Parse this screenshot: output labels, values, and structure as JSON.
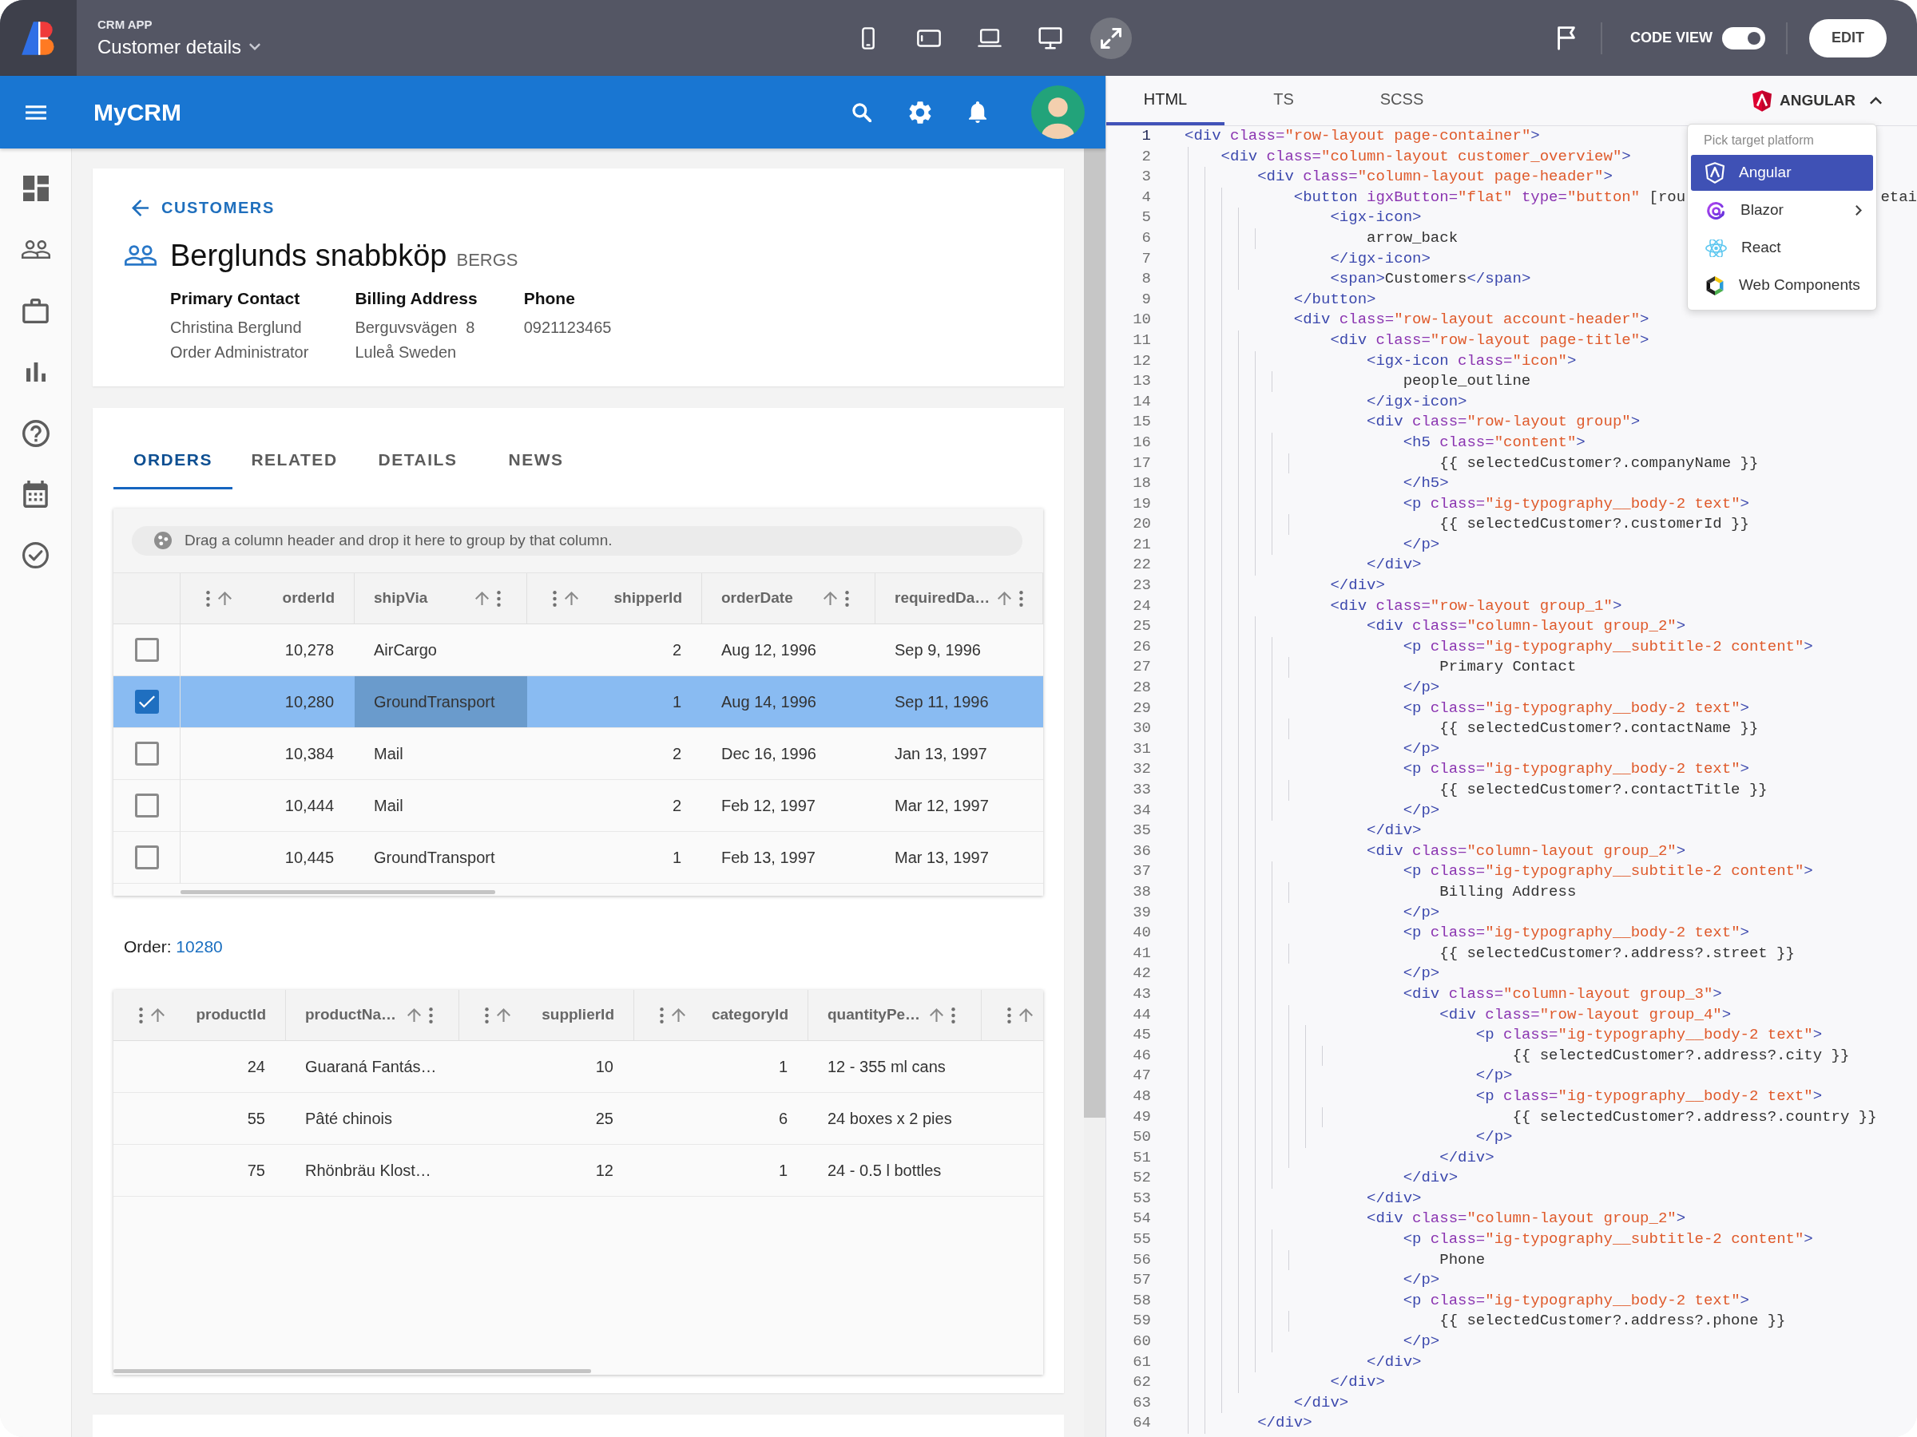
{
  "app_bar": {
    "app_label": "CRM APP",
    "page_title": "Customer details",
    "device_buttons": [
      {
        "kind": "phone",
        "selected": false
      },
      {
        "kind": "tablet",
        "selected": false
      },
      {
        "kind": "laptop",
        "selected": false
      },
      {
        "kind": "desktop",
        "selected": false
      },
      {
        "kind": "fullscreen",
        "selected": true
      }
    ],
    "code_view": {
      "label": "CODE VIEW",
      "on": true
    },
    "edit_button": "EDIT"
  },
  "preview": {
    "header": {
      "title": "MyCRM",
      "actions": [
        {
          "kind": "search"
        },
        {
          "kind": "settings"
        },
        {
          "kind": "notifications"
        }
      ]
    },
    "nav_rail": [
      {
        "kind": "dashboard"
      },
      {
        "kind": "contacts"
      },
      {
        "kind": "briefcase"
      },
      {
        "kind": "reports"
      },
      {
        "kind": "help"
      },
      {
        "kind": "calendar"
      },
      {
        "kind": "tasks"
      }
    ],
    "customer": {
      "back_link": "CUSTOMERS",
      "name": "Berglunds snabbköp",
      "customer_id": "BERGS",
      "fields": [
        {
          "label": "Primary Contact",
          "lines": [
            "Christina Berglund",
            "Order Administrator"
          ]
        },
        {
          "label": "Billing Address",
          "lines": [
            "Berguvsvägen  8",
            "Luleå Sweden"
          ]
        },
        {
          "label": "Phone",
          "lines": [
            "0921123465"
          ]
        }
      ]
    },
    "tabs": [
      {
        "label": "ORDERS",
        "selected": true
      },
      {
        "label": "RELATED",
        "selected": false
      },
      {
        "label": "DETAILS",
        "selected": false
      },
      {
        "label": "NEWS",
        "selected": false
      }
    ],
    "orders_grid": {
      "group_hint": "Drag a column header and drop it here to group by that column.",
      "columns": [
        {
          "label": "orderId",
          "kind": "number"
        },
        {
          "label": "shipVia",
          "kind": "text"
        },
        {
          "label": "shipperId",
          "kind": "number"
        },
        {
          "label": "orderDate",
          "kind": "text"
        },
        {
          "label": "requiredDa…",
          "kind": "text"
        }
      ],
      "rows": [
        {
          "selected": false,
          "cells": [
            {
              "text": "10,278",
              "active": false
            },
            {
              "text": "AirCargo",
              "active": false
            },
            {
              "text": "2",
              "active": false
            },
            {
              "text": "Aug 12, 1996",
              "active": false
            },
            {
              "text": "Sep 9, 1996",
              "active": false
            }
          ]
        },
        {
          "selected": true,
          "cells": [
            {
              "text": "10,280",
              "active": false
            },
            {
              "text": "GroundTransport",
              "active": true
            },
            {
              "text": "1",
              "active": false
            },
            {
              "text": "Aug 14, 1996",
              "active": false
            },
            {
              "text": "Sep 11, 1996",
              "active": false
            }
          ]
        },
        {
          "selected": false,
          "cells": [
            {
              "text": "10,384",
              "active": false
            },
            {
              "text": "Mail",
              "active": false
            },
            {
              "text": "2",
              "active": false
            },
            {
              "text": "Dec 16, 1996",
              "active": false
            },
            {
              "text": "Jan 13, 1997",
              "active": false
            }
          ]
        },
        {
          "selected": false,
          "cells": [
            {
              "text": "10,444",
              "active": false
            },
            {
              "text": "Mail",
              "active": false
            },
            {
              "text": "2",
              "active": false
            },
            {
              "text": "Feb 12, 1997",
              "active": false
            },
            {
              "text": "Mar 12, 1997",
              "active": false
            }
          ]
        },
        {
          "selected": false,
          "cells": [
            {
              "text": "10,445",
              "active": false
            },
            {
              "text": "GroundTransport",
              "active": false
            },
            {
              "text": "1",
              "active": false
            },
            {
              "text": "Feb 13, 1997",
              "active": false
            },
            {
              "text": "Mar 13, 1997",
              "active": false
            }
          ]
        }
      ]
    },
    "order_detail": {
      "label": "Order:",
      "value": "10280"
    },
    "products_grid": {
      "columns": [
        {
          "label": "productId",
          "kind": "number"
        },
        {
          "label": "productNa…",
          "kind": "text"
        },
        {
          "label": "supplierId",
          "kind": "number"
        },
        {
          "label": "categoryId",
          "kind": "number"
        },
        {
          "label": "quantityPe…",
          "kind": "text"
        },
        {
          "kind": "number"
        }
      ],
      "rows": [
        {
          "cells": [
            "24",
            "Guaraná Fantás…",
            "10",
            "1",
            "12 - 355 ml cans"
          ]
        },
        {
          "cells": [
            "55",
            "Pâté chinois",
            "25",
            "6",
            "24 boxes x 2 pies"
          ]
        },
        {
          "cells": [
            "75",
            "Rhönbräu Klost…",
            "12",
            "1",
            "24 - 0.5 l bottles"
          ]
        }
      ]
    }
  },
  "code_panel": {
    "tabs": [
      {
        "label": "HTML",
        "selected": true
      },
      {
        "label": "TS",
        "selected": false
      },
      {
        "label": "SCSS",
        "selected": false
      }
    ],
    "platform_button": {
      "label": "ANGULAR",
      "expanded": true
    },
    "platform_menu": {
      "header": "Pick target platform",
      "items": [
        {
          "kind": "angular",
          "label": "Angular",
          "selected": true,
          "submenu": false
        },
        {
          "kind": "blazor",
          "label": "Blazor",
          "selected": false,
          "submenu": true
        },
        {
          "kind": "react",
          "label": "React",
          "selected": false,
          "submenu": false
        },
        {
          "kind": "web_components",
          "label": "Web Components",
          "selected": false,
          "submenu": false
        }
      ]
    },
    "lines": [
      {
        "number": "1",
        "text": "<div class=\"row-layout page-container\">",
        "current": true
      },
      {
        "number": "2",
        "text": "    <div class=\"column-layout customer_overview\">",
        "current": false
      },
      {
        "number": "3",
        "text": "        <div class=\"column-layout page-header\">",
        "current": false
      },
      {
        "number": "4",
        "text": "            <button igxButton=\"flat\" type=\"button\" [rou",
        "tail": "etai",
        "current": false
      },
      {
        "number": "5",
        "text": "                <igx-icon>",
        "current": false
      },
      {
        "number": "6",
        "text": "                    arrow_back",
        "current": false
      },
      {
        "number": "7",
        "text": "                </igx-icon>",
        "current": false
      },
      {
        "number": "8",
        "text": "                <span>Customers</span>",
        "current": false
      },
      {
        "number": "9",
        "text": "            </button>",
        "current": false
      },
      {
        "number": "10",
        "text": "            <div class=\"row-layout account-header\">",
        "current": false
      },
      {
        "number": "11",
        "text": "                <div class=\"row-layout page-title\">",
        "current": false
      },
      {
        "number": "12",
        "text": "                    <igx-icon class=\"icon\">",
        "current": false
      },
      {
        "number": "13",
        "text": "                        people_outline",
        "current": false
      },
      {
        "number": "14",
        "text": "                    </igx-icon>",
        "current": false
      },
      {
        "number": "15",
        "text": "                    <div class=\"row-layout group\">",
        "current": false
      },
      {
        "number": "16",
        "text": "                        <h5 class=\"content\">",
        "current": false
      },
      {
        "number": "17",
        "text": "                            {{ selectedCustomer?.companyName }}",
        "current": false
      },
      {
        "number": "18",
        "text": "                        </h5>",
        "current": false
      },
      {
        "number": "19",
        "text": "                        <p class=\"ig-typography__body-2 text\">",
        "current": false
      },
      {
        "number": "20",
        "text": "                            {{ selectedCustomer?.customerId }}",
        "current": false
      },
      {
        "number": "21",
        "text": "                        </p>",
        "current": false
      },
      {
        "number": "22",
        "text": "                    </div>",
        "current": false
      },
      {
        "number": "23",
        "text": "                </div>",
        "current": false
      },
      {
        "number": "24",
        "text": "                <div class=\"row-layout group_1\">",
        "current": false
      },
      {
        "number": "25",
        "text": "                    <div class=\"column-layout group_2\">",
        "current": false
      },
      {
        "number": "26",
        "text": "                        <p class=\"ig-typography__subtitle-2 content\">",
        "current": false
      },
      {
        "number": "27",
        "text": "                            Primary Contact",
        "current": false
      },
      {
        "number": "28",
        "text": "                        </p>",
        "current": false
      },
      {
        "number": "29",
        "text": "                        <p class=\"ig-typography__body-2 text\">",
        "current": false
      },
      {
        "number": "30",
        "text": "                            {{ selectedCustomer?.contactName }}",
        "current": false
      },
      {
        "number": "31",
        "text": "                        </p>",
        "current": false
      },
      {
        "number": "32",
        "text": "                        <p class=\"ig-typography__body-2 text\">",
        "current": false
      },
      {
        "number": "33",
        "text": "                            {{ selectedCustomer?.contactTitle }}",
        "current": false
      },
      {
        "number": "34",
        "text": "                        </p>",
        "current": false
      },
      {
        "number": "35",
        "text": "                    </div>",
        "current": false
      },
      {
        "number": "36",
        "text": "                    <div class=\"column-layout group_2\">",
        "current": false
      },
      {
        "number": "37",
        "text": "                        <p class=\"ig-typography__subtitle-2 content\">",
        "current": false
      },
      {
        "number": "38",
        "text": "                            Billing Address",
        "current": false
      },
      {
        "number": "39",
        "text": "                        </p>",
        "current": false
      },
      {
        "number": "40",
        "text": "                        <p class=\"ig-typography__body-2 text\">",
        "current": false
      },
      {
        "number": "41",
        "text": "                            {{ selectedCustomer?.address?.street }}",
        "current": false
      },
      {
        "number": "42",
        "text": "                        </p>",
        "current": false
      },
      {
        "number": "43",
        "text": "                        <div class=\"column-layout group_3\">",
        "current": false
      },
      {
        "number": "44",
        "text": "                            <div class=\"row-layout group_4\">",
        "current": false
      },
      {
        "number": "45",
        "text": "                                <p class=\"ig-typography__body-2 text\">",
        "current": false
      },
      {
        "number": "46",
        "text": "                                    {{ selectedCustomer?.address?.city }}",
        "current": false
      },
      {
        "number": "47",
        "text": "                                </p>",
        "current": false
      },
      {
        "number": "48",
        "text": "                                <p class=\"ig-typography__body-2 text\">",
        "current": false
      },
      {
        "number": "49",
        "text": "                                    {{ selectedCustomer?.address?.country }}",
        "current": false
      },
      {
        "number": "50",
        "text": "                                </p>",
        "current": false
      },
      {
        "number": "51",
        "text": "                            </div>",
        "current": false
      },
      {
        "number": "52",
        "text": "                        </div>",
        "current": false
      },
      {
        "number": "53",
        "text": "                    </div>",
        "current": false
      },
      {
        "number": "54",
        "text": "                    <div class=\"column-layout group_2\">",
        "current": false
      },
      {
        "number": "55",
        "text": "                        <p class=\"ig-typography__subtitle-2 content\">",
        "current": false
      },
      {
        "number": "56",
        "text": "                            Phone",
        "current": false
      },
      {
        "number": "57",
        "text": "                        </p>",
        "current": false
      },
      {
        "number": "58",
        "text": "                        <p class=\"ig-typography__body-2 text\">",
        "current": false
      },
      {
        "number": "59",
        "text": "                            {{ selectedCustomer?.address?.phone }}",
        "current": false
      },
      {
        "number": "60",
        "text": "                        </p>",
        "current": false
      },
      {
        "number": "61",
        "text": "                    </div>",
        "current": false
      },
      {
        "number": "62",
        "text": "                </div>",
        "current": false
      },
      {
        "number": "63",
        "text": "            </div>",
        "current": false
      },
      {
        "number": "64",
        "text": "        </div>",
        "current": false
      }
    ]
  }
}
